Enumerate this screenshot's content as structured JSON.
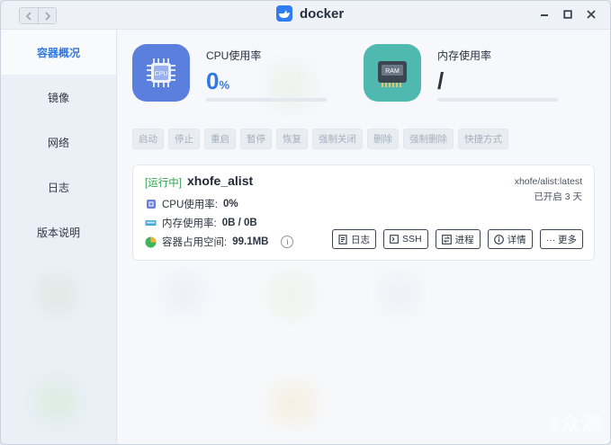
{
  "window": {
    "title": "docker",
    "icon": "docker-whale-icon",
    "accent_color": "#2f78e6",
    "controls": [
      "minimize-icon",
      "maximize-icon",
      "close-icon"
    ]
  },
  "sidebar": {
    "items": [
      {
        "label": "容器概况",
        "active": true
      },
      {
        "label": "镜像",
        "active": false
      },
      {
        "label": "网络",
        "active": false
      },
      {
        "label": "日志",
        "active": false
      },
      {
        "label": "版本说明",
        "active": false
      }
    ]
  },
  "stats": {
    "cpu": {
      "label": "CPU使用率",
      "value": "0",
      "unit": "%",
      "icon_text": "CPU",
      "progress": 0
    },
    "memory": {
      "label": "内存使用率",
      "value": "/",
      "icon_text": "RAM",
      "progress": 0
    }
  },
  "toolbar": {
    "buttons": [
      "启动",
      "停止",
      "重启",
      "暂停",
      "恢复",
      "强制关闭",
      "删除",
      "强制删除",
      "快捷方式"
    ]
  },
  "container": {
    "status": "[运行中]",
    "name": "xhofe_alist",
    "image": "xhofe/alist:latest",
    "uptime": "已开启 3 天",
    "status_color": "#2ea44f",
    "metrics": {
      "cpu": {
        "label": "CPU使用率:",
        "value": "0%"
      },
      "memory": {
        "label": "内存使用率:",
        "value": "0B / 0B"
      },
      "disk": {
        "label": "容器占用空间:",
        "value": "99.1MB"
      }
    },
    "actions": {
      "log": "日志",
      "ssh": "SSH",
      "process": "进程",
      "details": "详情",
      "more": "··· 更多"
    }
  },
  "watermark": {
    "small": "新浪",
    "big": "众测"
  }
}
